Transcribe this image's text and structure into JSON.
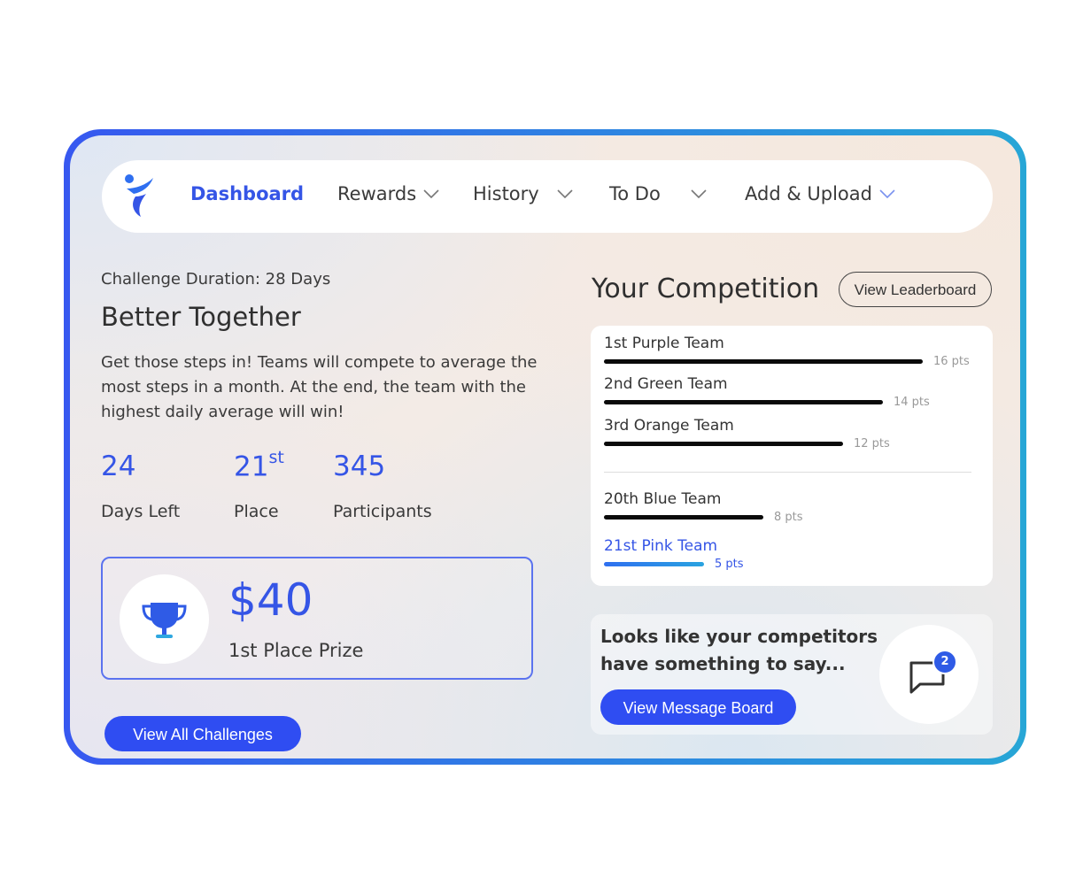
{
  "nav": {
    "items": [
      {
        "label": "Dashboard",
        "active": true
      },
      {
        "label": "Rewards",
        "active": false
      },
      {
        "label": "History",
        "active": false
      },
      {
        "label": "To Do",
        "active": false
      },
      {
        "label": "Add & Upload",
        "active": false
      }
    ]
  },
  "challenge": {
    "duration": "Challenge Duration: 28 Days",
    "title": "Better Together",
    "description": "Get those steps in! Teams will compete to average the most steps in a month. At the end, the team with the highest daily average will win!",
    "stats": [
      {
        "value": "24",
        "label": "Days Left"
      },
      {
        "value": "21",
        "suffix": "st",
        "label": "Place"
      },
      {
        "value": "345",
        "label": "Participants"
      }
    ],
    "prize": {
      "amount": "$40",
      "label": "1st Place Prize"
    },
    "view_all_label": "View All Challenges"
  },
  "competition": {
    "title": "Your Competition",
    "leaderboard_label": "View Leaderboard",
    "max_points": 16,
    "teams": [
      {
        "name": "1st Purple Team",
        "points": 16,
        "points_label": "16 pts",
        "mine": false
      },
      {
        "name": "2nd Green Team",
        "points": 14,
        "points_label": "14 pts",
        "mine": false
      },
      {
        "name": "3rd Orange Team",
        "points": 12,
        "points_label": "12 pts",
        "mine": false
      },
      {
        "name": "20th Blue Team",
        "points": 8,
        "points_label": "8 pts",
        "mine": false
      },
      {
        "name": "21st Pink Team",
        "points": 5,
        "points_label": "5 pts",
        "mine": true
      }
    ]
  },
  "message": {
    "text": "Looks like your competitors have something to say...",
    "button_label": "View Message Board",
    "badge_count": "2"
  },
  "colors": {
    "accent": "#3555e6",
    "button": "#2f4df2",
    "frame_start": "#3758f0",
    "frame_end": "#27a6d6"
  }
}
